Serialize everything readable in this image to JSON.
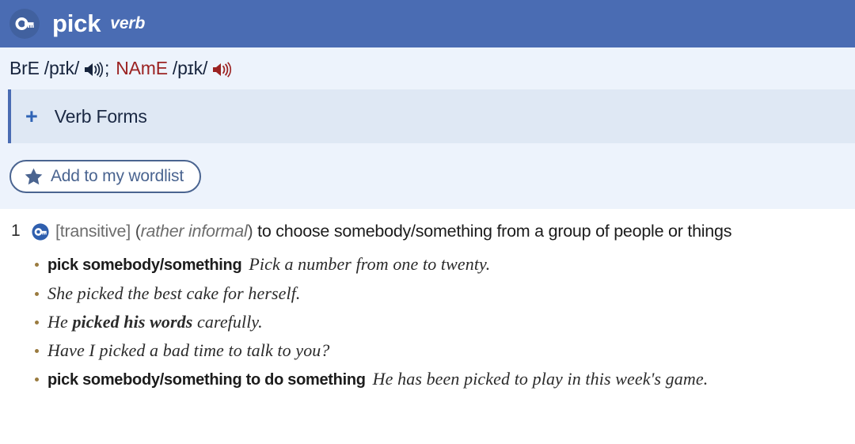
{
  "header": {
    "headword": "pick",
    "part_of_speech": "verb",
    "icon": "key-icon",
    "background_color": "#4a6cb3"
  },
  "pronunciation": {
    "bre_label": "BrE",
    "bre_ipa": "/pɪk/",
    "bre_color": "#17243d",
    "separator": ";",
    "name_label": "NAmE",
    "name_ipa": "/pɪk/",
    "name_color": "#9b2222",
    "bre_audio_icon": "speaker-icon",
    "name_audio_icon": "speaker-icon"
  },
  "verb_forms": {
    "toggle_icon": "plus-icon",
    "label": "Verb Forms",
    "accent_color": "#4a6cb3"
  },
  "wordlist": {
    "icon": "star-icon",
    "label": "Add to my wordlist",
    "color": "#4a6490"
  },
  "senses": [
    {
      "number": "1",
      "icon": "key-icon",
      "grammar": "[transitive]",
      "register_open": "(",
      "register": "rather informal",
      "register_close": ")",
      "definition": "to choose somebody/something from a group of people or things",
      "examples": [
        {
          "pattern": "pick somebody/something",
          "before": "",
          "bold": "",
          "after": "Pick a number from one to twenty."
        },
        {
          "pattern": "",
          "before": "She picked the best cake for herself.",
          "bold": "",
          "after": ""
        },
        {
          "pattern": "",
          "before": "He ",
          "bold": "picked his words",
          "after": " carefully."
        },
        {
          "pattern": "",
          "before": "Have I picked a bad time to talk to you?",
          "bold": "",
          "after": ""
        },
        {
          "pattern": "pick somebody/something to do something",
          "before": "",
          "bold": "",
          "after": "He has been picked to play in this week's game."
        }
      ]
    }
  ]
}
